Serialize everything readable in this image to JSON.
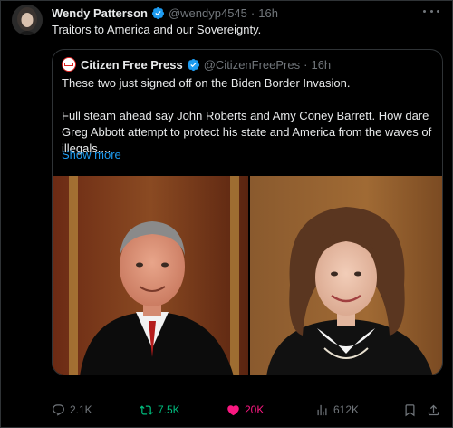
{
  "tweet": {
    "display_name": "Wendy Patterson",
    "handle": "@wendyp4545",
    "dot": "·",
    "time": "16h",
    "text": "Traitors to America and our Sovereignty."
  },
  "quote": {
    "display_name": "Citizen Free Press",
    "handle": "@CitizenFreePres",
    "dot": "·",
    "time": "16h",
    "paragraph1": "These two just signed off on the Biden Border Invasion.",
    "paragraph2": "Full steam ahead say John Roberts and Amy Coney Barrett. How dare Greg Abbott attempt to protect his state and America from the waves of illegals....",
    "show_more": "Show more"
  },
  "actions": {
    "replies": "2.1K",
    "reposts": "7.5K",
    "likes": "20K",
    "views": "612K"
  },
  "icons": {
    "verified": "verified-badge-icon",
    "more": "more-options-icon",
    "reply": "reply-icon",
    "repost": "repost-icon",
    "like": "heart-icon",
    "views": "views-icon",
    "bookmark": "bookmark-icon",
    "share": "share-icon"
  },
  "colors": {
    "background": "#000000",
    "text": "#e7e9ea",
    "muted": "#71767b",
    "link": "#1d9bf0",
    "repost_active": "#00ba7c",
    "like_active": "#f91880"
  }
}
